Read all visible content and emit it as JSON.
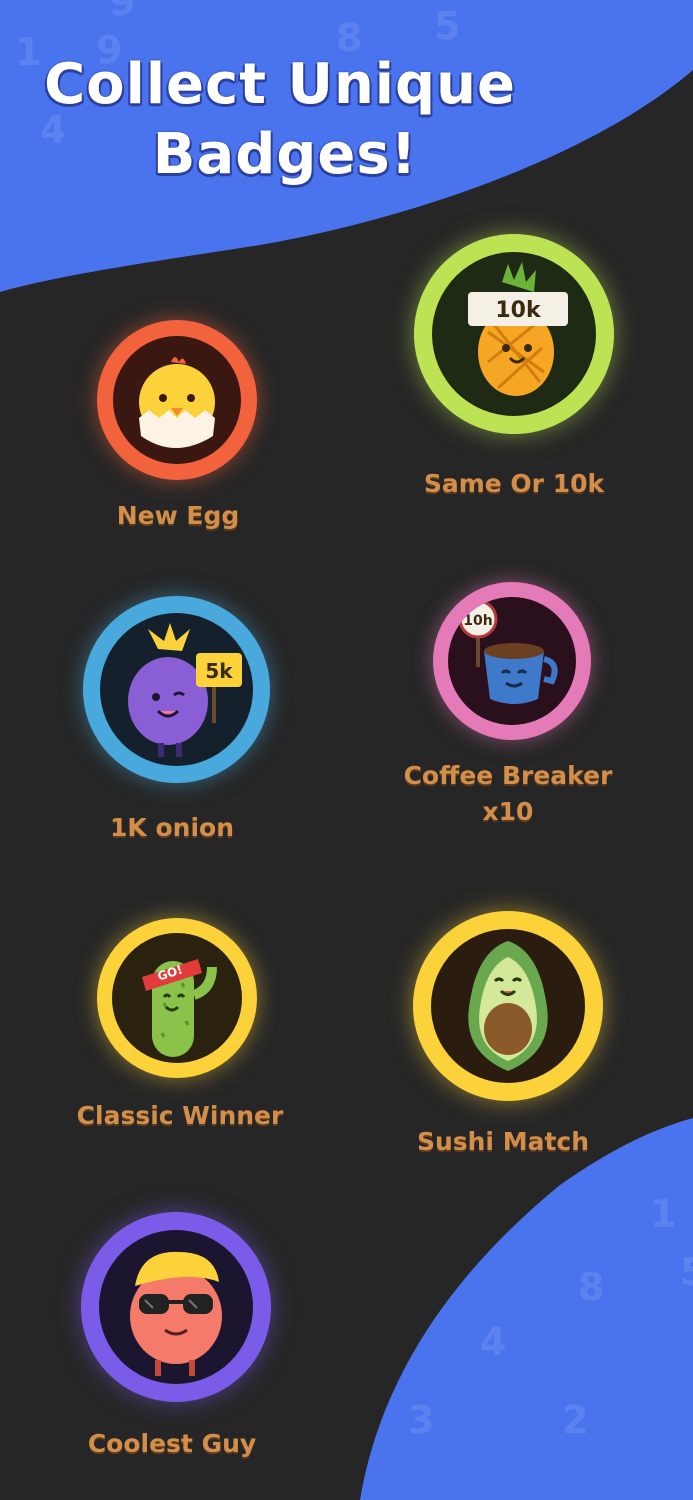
{
  "header": {
    "title_line1": "Collect Unique",
    "title_line2": "Badges!"
  },
  "background_digits": {
    "top": [
      "1",
      "9",
      "4",
      "8",
      "5",
      "9"
    ],
    "bottom": [
      "1",
      "5",
      "8",
      "4",
      "3",
      "2"
    ]
  },
  "colors": {
    "background": "#262626",
    "blob": "#4a74ee",
    "label": "#d38f4a"
  },
  "badges": [
    {
      "name": "New Egg",
      "icon": "chick-egg-icon",
      "ring_color": "#f2623d",
      "inner_color": "#3a1710"
    },
    {
      "name": "Same Or 10k",
      "icon": "pineapple-sign-icon",
      "ring_color": "#bde354",
      "inner_color": "#1e2a14",
      "sign_text": "10k"
    },
    {
      "name": "1K onion",
      "icon": "onion-sign-icon",
      "ring_color": "#49a9dc",
      "inner_color": "#15202d",
      "sign_text": "5k"
    },
    {
      "name": "Coffee Breaker x10",
      "name_line1": "Coffee Breaker",
      "name_line2": "x10",
      "icon": "coffee-cup-icon",
      "ring_color": "#e57ab8",
      "inner_color": "#2a0f1c",
      "sign_text": "10h"
    },
    {
      "name": "Classic Winner",
      "icon": "cucumber-headband-icon",
      "ring_color": "#fbd23a",
      "inner_color": "#2a210f",
      "sign_text": "GO!"
    },
    {
      "name": "Sushi Match",
      "icon": "avocado-icon",
      "ring_color": "#fbd23a",
      "inner_color": "#2a1d0f"
    },
    {
      "name": "Coolest Guy",
      "icon": "cool-peach-sunglasses-icon",
      "ring_color": "#7a5ce9",
      "inner_color": "#1b1530"
    }
  ]
}
